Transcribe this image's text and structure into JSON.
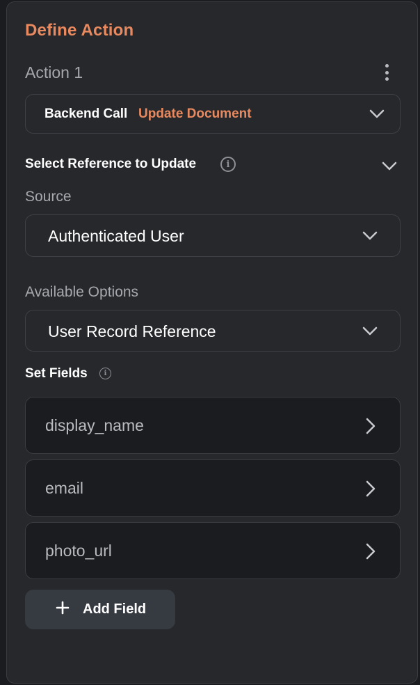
{
  "panel": {
    "title": "Define Action"
  },
  "action": {
    "label": "Action 1",
    "kind": "Backend Call",
    "subtype": "Update Document"
  },
  "reference": {
    "section_title": "Select Reference to Update",
    "source_label": "Source",
    "source_value": "Authenticated User",
    "options_label": "Available Options",
    "options_value": "User Record Reference"
  },
  "set_fields": {
    "title": "Set Fields",
    "fields": [
      {
        "name": "display_name"
      },
      {
        "name": "email"
      },
      {
        "name": "photo_url"
      }
    ],
    "add_label": "Add Field"
  },
  "colors": {
    "accent": "#e8895f",
    "panel_bg": "#26282c",
    "page_bg": "#1b1c1f",
    "border": "#3e4046",
    "button_bg": "#363a41"
  },
  "icons": {
    "more": "more-vertical-icon",
    "dropdown": "chevron-down-icon",
    "info": "info-icon",
    "row": "chevron-right-icon",
    "add": "plus-icon"
  }
}
